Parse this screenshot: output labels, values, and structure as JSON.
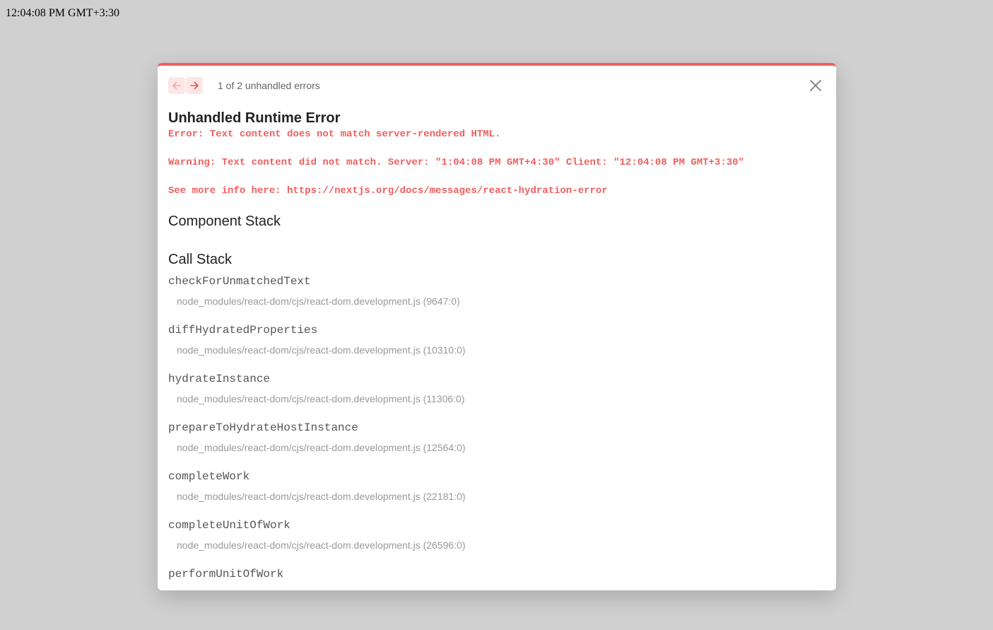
{
  "page": {
    "time_text": "12:04:08 PM GMT+3:30"
  },
  "overlay": {
    "counter_text": "1 of 2 unhandled errors",
    "title": "Unhandled Runtime Error",
    "messages": {
      "error": "Error: Text content does not match server-rendered HTML.",
      "warning": "Warning: Text content did not match. Server: \"1:04:08 PM GMT+4:30\" Client: \"12:04:08 PM GMT+3:30\"",
      "more_info": "See more info here: https://nextjs.org/docs/messages/react-hydration-error"
    },
    "component_stack_heading": "Component Stack",
    "call_stack_heading": "Call Stack",
    "frames": [
      {
        "fn": "checkForUnmatchedText",
        "file": "node_modules/react-dom/cjs/react-dom.development.js (9647:0)"
      },
      {
        "fn": "diffHydratedProperties",
        "file": "node_modules/react-dom/cjs/react-dom.development.js (10310:0)"
      },
      {
        "fn": "hydrateInstance",
        "file": "node_modules/react-dom/cjs/react-dom.development.js (11306:0)"
      },
      {
        "fn": "prepareToHydrateHostInstance",
        "file": "node_modules/react-dom/cjs/react-dom.development.js (12564:0)"
      },
      {
        "fn": "completeWork",
        "file": "node_modules/react-dom/cjs/react-dom.development.js (22181:0)"
      },
      {
        "fn": "completeUnitOfWork",
        "file": "node_modules/react-dom/cjs/react-dom.development.js (26596:0)"
      },
      {
        "fn": "performUnitOfWork",
        "file": ""
      }
    ],
    "icons": {
      "prev": "arrow-left-icon",
      "next": "arrow-right-icon",
      "close": "close-icon"
    }
  },
  "colors": {
    "accent": "#ef5f5f",
    "backdrop": "#d0d0d0"
  }
}
